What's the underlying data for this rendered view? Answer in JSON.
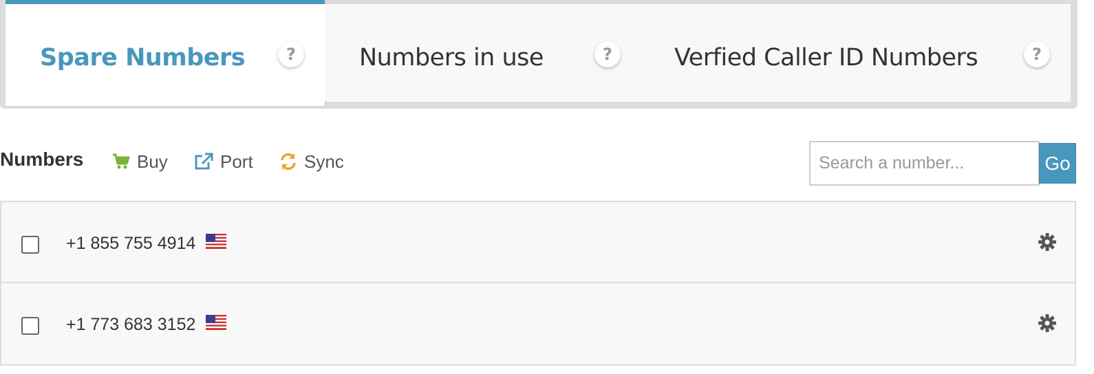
{
  "tabs": [
    {
      "label": "Spare Numbers",
      "active": true
    },
    {
      "label": "Numbers in use",
      "active": false
    },
    {
      "label": "Verfied Caller ID Numbers",
      "active": false
    }
  ],
  "help_glyph": "?",
  "toolbar": {
    "title": "Numbers",
    "buy_label": "Buy",
    "port_label": "Port",
    "sync_label": "Sync"
  },
  "search": {
    "placeholder": "Search a number...",
    "value": "",
    "go_label": "Go"
  },
  "numbers": [
    {
      "number": "+1 855 755 4914",
      "country_flag": "us-flag-icon",
      "checked": false
    },
    {
      "number": "+1 773 683 3152",
      "country_flag": "us-flag-icon",
      "checked": false
    }
  ],
  "colors": {
    "accent": "#4a97bd",
    "buy_icon": "#7bb33a",
    "port_icon": "#4a97bd",
    "sync_icon": "#f0a22e",
    "gear_icon": "#555555"
  },
  "icons": {
    "help": "question-circle-icon",
    "buy": "shopping-cart-icon",
    "port": "external-link-icon",
    "sync": "refresh-icon",
    "row_settings": "gear-icon"
  }
}
